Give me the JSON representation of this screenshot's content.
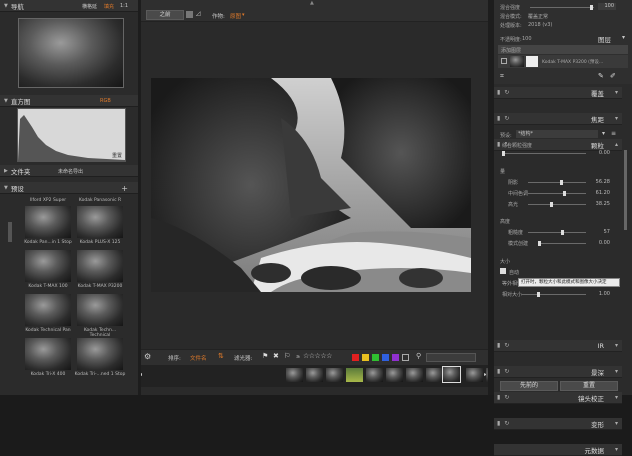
{
  "left": {
    "navigator": {
      "title": "导航",
      "fit": "横格延",
      "fill": "填充",
      "ratio": "1:1"
    },
    "histogram": {
      "title": "直方图",
      "channel": "RGB",
      "reset": "重置"
    },
    "folder": {
      "title": "文件夹",
      "value": "未命名导出"
    },
    "presets": {
      "title": "预设",
      "items": [
        "Ilford XP2 Super",
        "Kodak Panasonic R",
        "Kodak Pan...in 1 Stop",
        "Kodak PLUS-X 125",
        "Kodak T-MAX 100",
        "Kodak T-MAX P3200",
        "Kodak Technical Pan",
        "Kodak Techn... Technical",
        "Kodak Tri-X 400",
        "Kodak Tri-...ned 1 Stop"
      ]
    }
  },
  "toolbar": {
    "before": "之前",
    "compare_label": "作物:",
    "compare_value": "原图"
  },
  "bottombar": {
    "sort_label": "排序:",
    "sort_value": "文件名",
    "filter_label": "滤光器:",
    "rating_prefix": "≥"
  },
  "right": {
    "layers_top": {
      "blend_strength": "混合强度",
      "blend_value": "100",
      "blend_mode_label": "混合模式:",
      "blend_mode": "覆盖正常",
      "process_label": "处理版本:",
      "process": "2018 (v3)"
    },
    "opacity": {
      "label": "不透明度:",
      "value": "100",
      "layers": "图层"
    },
    "add_layer": "添加图层",
    "layer_name": "Kodak T-MAX P3200 (预设...",
    "sections_top": [
      "覆盖",
      "焦距",
      "颗粒"
    ],
    "grain": {
      "preset_label": "预设:",
      "preset_value": "*结构*",
      "amount_label": "综合颗粒强度",
      "amount": "0.00",
      "group1": "量",
      "rows1": [
        {
          "label": "阴影",
          "value": "56.28"
        },
        {
          "label": "中间色调",
          "value": "61.20"
        },
        {
          "label": "高光",
          "value": "38.25"
        }
      ],
      "group2": "高度",
      "rows2": [
        {
          "label": "粗糙度",
          "value": "57"
        },
        {
          "label": "模式创建",
          "value": "0.00"
        }
      ],
      "group3": "大小",
      "auto": "自动",
      "tooltip": "打开时，颗粒大小和此模式和图像大小决定",
      "rows3": [
        {
          "label": "等外相性",
          "value": ""
        },
        {
          "label": "相对大小",
          "value": "1.00"
        }
      ]
    },
    "sections_bottom": [
      "IR",
      "景深",
      "镜头校正",
      "变形",
      "元数据"
    ],
    "buttons": {
      "previous": "先前的",
      "reset": "重置"
    }
  },
  "colors": {
    "accent": "#e07a2a",
    "bg": "#2b2b2b",
    "swatches": [
      "#e02020",
      "#e8c020",
      "#30c030",
      "#3060e0",
      "#9030d0"
    ]
  }
}
